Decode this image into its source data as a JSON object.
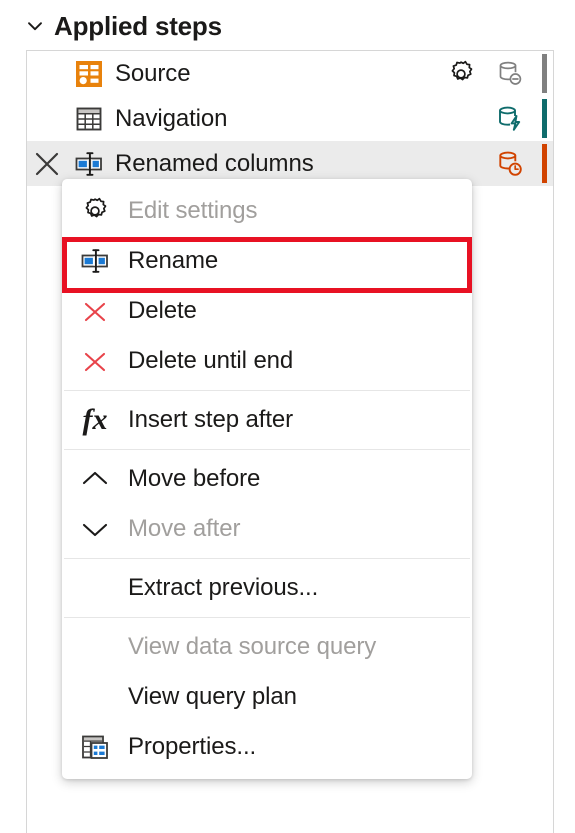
{
  "header": {
    "title": "Applied steps",
    "toggle_icon": "chevron-down-icon"
  },
  "steps": [
    {
      "label": "Source",
      "icon": "source-form-icon",
      "icon_color": "#e8820c",
      "has_gear": true,
      "gear_icon": "gear-icon",
      "status_icon": "database-minus-icon",
      "status_icon_color": "#808080",
      "status_bar_color": "#808080",
      "selected": false,
      "has_delete": false
    },
    {
      "label": "Navigation",
      "icon": "table-grid-icon",
      "icon_color": "#3b3a39",
      "has_gear": false,
      "status_icon": "database-lightning-icon",
      "status_icon_color": "#0f6c6c",
      "status_bar_color": "#0f6c6c",
      "selected": false,
      "has_delete": false
    },
    {
      "label": "Renamed columns",
      "icon": "rename-icon",
      "icon_color": "#1b7ad4",
      "has_gear": false,
      "status_icon": "database-clock-icon",
      "status_icon_color": "#d14300",
      "status_bar_color": "#d14300",
      "selected": true,
      "has_delete": true,
      "delete_icon": "close-x-icon"
    }
  ],
  "context_menu": {
    "items": [
      {
        "label": "Edit settings",
        "icon": "gear-icon",
        "disabled": true,
        "separator_after": false
      },
      {
        "label": "Rename",
        "icon": "rename-icon",
        "disabled": false,
        "separator_after": false,
        "highlighted": true
      },
      {
        "label": "Delete",
        "icon": "red-x-icon",
        "disabled": false,
        "separator_after": false
      },
      {
        "label": "Delete until end",
        "icon": "red-x-icon",
        "disabled": false,
        "separator_after": true
      },
      {
        "label": "Insert step after",
        "icon": "fx-icon",
        "disabled": false,
        "separator_after": true
      },
      {
        "label": "Move before",
        "icon": "chevron-up-icon",
        "disabled": false,
        "separator_after": false
      },
      {
        "label": "Move after",
        "icon": "chevron-down-icon",
        "disabled": true,
        "separator_after": true
      },
      {
        "label": "Extract previous...",
        "icon": "none",
        "disabled": false,
        "separator_after": true
      },
      {
        "label": "View data source query",
        "icon": "none",
        "disabled": true,
        "separator_after": false
      },
      {
        "label": "View query plan",
        "icon": "none",
        "disabled": false,
        "separator_after": false
      },
      {
        "label": "Properties...",
        "icon": "properties-icon",
        "disabled": false,
        "separator_after": false
      }
    ],
    "highlight_color": "#e81123"
  }
}
